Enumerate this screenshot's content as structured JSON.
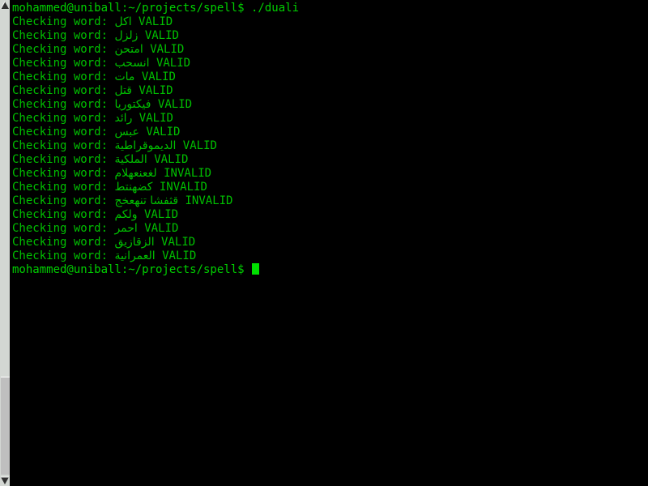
{
  "window": {
    "title": "mohammed@uniball: ~/projects/spell",
    "background_color": "#000000",
    "foreground_color": "#00c000",
    "cursor_color": "#00e000"
  },
  "scrollbar": {
    "trough_color": "#d3d7d3",
    "thumb_color": "#bfbfbf",
    "up_arrow_icon": "scroll-up-arrow-icon",
    "down_arrow_icon": "scroll-down-arrow-icon"
  },
  "terminal": {
    "prompt": "mohammed@uniball:~/projects/spell$",
    "command": "./duali",
    "label_checking": "Checking word:",
    "status_valid": "VALID",
    "status_invalid": "INVALID",
    "lines": [
      {
        "type": "prompt",
        "prompt": "mohammed@uniball:~/projects/spell$",
        "command": " ./duali"
      },
      {
        "type": "check",
        "label": "Checking word: ",
        "word": "اكل",
        "status": "VALID"
      },
      {
        "type": "check",
        "label": "Checking word: ",
        "word": "زلزل",
        "status": "VALID"
      },
      {
        "type": "check",
        "label": "Checking word: ",
        "word": "امتحن",
        "status": "VALID"
      },
      {
        "type": "check",
        "label": "Checking word: ",
        "word": "انسحب",
        "status": "VALID"
      },
      {
        "type": "check",
        "label": "Checking word: ",
        "word": "مات",
        "status": "VALID"
      },
      {
        "type": "check",
        "label": "Checking word: ",
        "word": "قتل",
        "status": "VALID"
      },
      {
        "type": "check",
        "label": "Checking word: ",
        "word": "فيكتوريا",
        "status": "VALID"
      },
      {
        "type": "check",
        "label": "Checking word: ",
        "word": "رائد",
        "status": "VALID"
      },
      {
        "type": "check",
        "label": "Checking word: ",
        "word": "عبس",
        "status": "VALID"
      },
      {
        "type": "check",
        "label": "Checking word: ",
        "word": "الديموقراطية",
        "status": "VALID"
      },
      {
        "type": "check",
        "label": "Checking word: ",
        "word": "الملكية",
        "status": "VALID"
      },
      {
        "type": "check",
        "label": "Checking word: ",
        "word": "لغعنعهلام",
        "status": "INVALID"
      },
      {
        "type": "check",
        "label": "Checking word: ",
        "word": "كضهنتط",
        "status": "INVALID"
      },
      {
        "type": "check",
        "label": "Checking word: ",
        "word": "قثفشا تنهعخج",
        "status": "INVALID"
      },
      {
        "type": "check",
        "label": "Checking word: ",
        "word": "ولكم",
        "status": "VALID"
      },
      {
        "type": "check",
        "label": "Checking word: ",
        "word": "احمر",
        "status": "VALID"
      },
      {
        "type": "check",
        "label": "Checking word: ",
        "word": "الزقازيق",
        "status": "VALID"
      },
      {
        "type": "check",
        "label": "Checking word: ",
        "word": "العمرانية",
        "status": "VALID"
      },
      {
        "type": "prompt-cursor",
        "prompt": "mohammed@uniball:~/projects/spell$",
        "command": " "
      }
    ]
  }
}
